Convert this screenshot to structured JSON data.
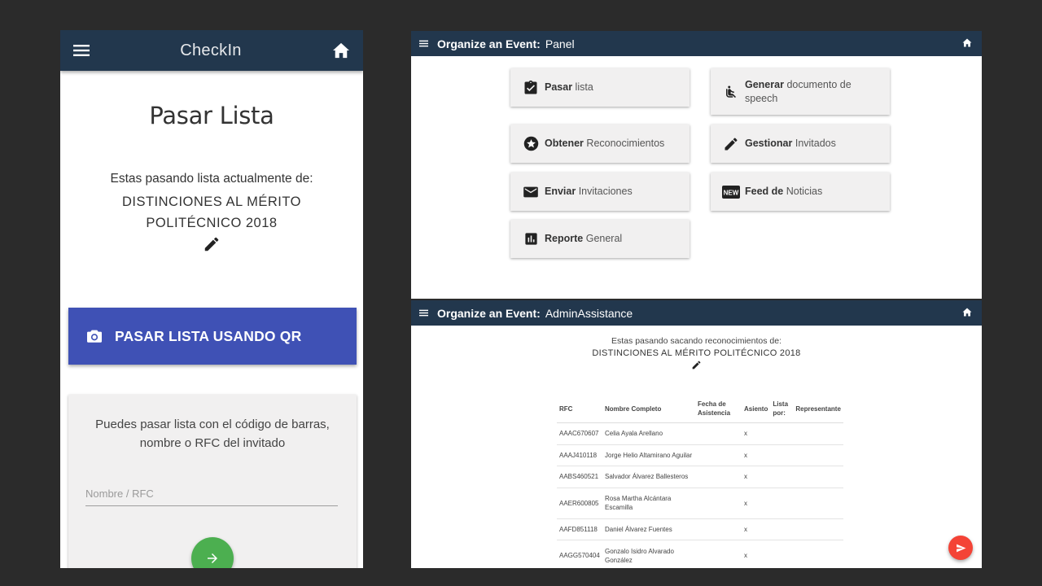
{
  "phone": {
    "app_title": "CheckIn",
    "page_title": "Pasar Lista",
    "subtitle": "Estas pasando lista actualmente de:",
    "event_line1": "DISTINCIONES AL MÉRITO",
    "event_line2": "POLITÉCNICO 2018",
    "qr_button_label": "PASAR LISTA USANDO QR",
    "search_text_line1": "Puedes pasar lista con el código de barras,",
    "search_text_line2": "nombre o RFC del invitado",
    "search_placeholder": "Nombre / RFC",
    "search_value": ""
  },
  "panel_window": {
    "title_bold": "Organize an Event:",
    "title_rest": "Panel",
    "tiles": [
      {
        "bold": "Pasar",
        "rest": "lista",
        "icon": "clipboard-check-icon"
      },
      {
        "bold": "Generar",
        "rest": "documento de",
        "rest2": "speech",
        "icon": "seat-icon"
      },
      {
        "bold": "Obtener",
        "rest": "Reconocimientos",
        "icon": "star-circle-icon"
      },
      {
        "bold": "Gestionar",
        "rest": "Invitados",
        "icon": "pencil-icon"
      },
      {
        "bold": "Enviar",
        "rest": "Invitaciones",
        "icon": "mail-icon"
      },
      {
        "bold": "Feed de",
        "rest": "Noticias",
        "icon": "new-badge-icon",
        "badge": "NEW"
      },
      {
        "bold": "Reporte",
        "rest": "General",
        "icon": "bar-chart-icon"
      }
    ]
  },
  "admin_window": {
    "title_bold": "Organize an Event:",
    "title_rest": "AdminAssistance",
    "subtitle": "Estas pasando sacando reconocimientos de:",
    "event": "DISTINCIONES AL MÉRITO POLITÉCNICO 2018",
    "table": {
      "headers": {
        "rfc": "RFC",
        "name": "Nombre Completo",
        "date_l1": "Fecha de",
        "date_l2": "Asistencia",
        "seat": "Asiento",
        "list_l1": "Lista",
        "list_l2": "por:",
        "rep": "Representante"
      },
      "rows": [
        {
          "rfc": "AAAC670607",
          "name": "Celia Ayala Arellano",
          "date": "",
          "seat": "x",
          "list": "",
          "rep": ""
        },
        {
          "rfc": "AAAJ410118",
          "name": "Jorge Helio Altamirano Aguilar",
          "date": "",
          "seat": "x",
          "list": "",
          "rep": ""
        },
        {
          "rfc": "AABS460521",
          "name": "Salvador Álvarez Ballesteros",
          "date": "",
          "seat": "x",
          "list": "",
          "rep": ""
        },
        {
          "rfc": "AAER600805",
          "name": "Rosa Martha Alcántara",
          "name2": "Escamilla",
          "date": "",
          "seat": "x",
          "list": "",
          "rep": ""
        },
        {
          "rfc": "AAFD851118",
          "name": "Daniel Álvarez Fuentes",
          "date": "",
          "seat": "x",
          "list": "",
          "rep": ""
        },
        {
          "rfc": "AAGG570404",
          "name": "Gonzalo Isidro Alvarado",
          "name2": "González",
          "date": "",
          "seat": "x",
          "list": "",
          "rep": ""
        }
      ]
    }
  },
  "colors": {
    "appbar": "#22374d",
    "qr_button": "#3f51b5",
    "go_button": "#4caf50",
    "fab": "#f44336",
    "tile_bg": "#f1f0f0"
  }
}
